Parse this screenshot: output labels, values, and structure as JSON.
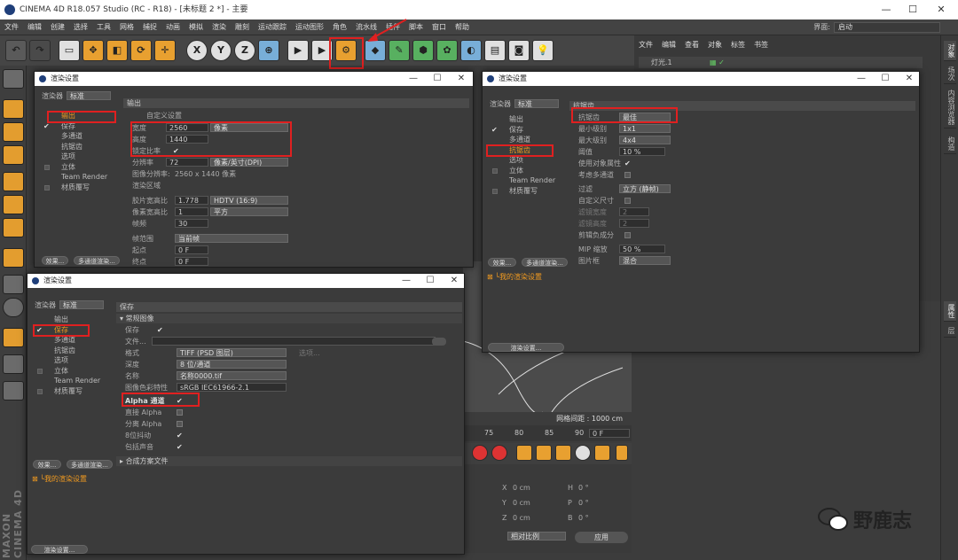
{
  "app": {
    "title": "CINEMA 4D R18.057 Studio (RC - R18) - [未标题 2 *] - 主要"
  },
  "menubar": {
    "items": [
      "文件",
      "编辑",
      "创建",
      "选择",
      "工具",
      "网格",
      "捕捉",
      "动画",
      "模拟",
      "渲染",
      "雕刻",
      "运动跟踪",
      "运动图形",
      "角色",
      "流水线",
      "插件",
      "脚本",
      "窗口",
      "帮助"
    ],
    "layout_label": "界面:",
    "layout_value": "启动"
  },
  "toolbar": {
    "x": "X",
    "y": "Y",
    "z": "Z"
  },
  "objmgr": {
    "menu": [
      "文件",
      "编辑",
      "查看",
      "对象",
      "标签",
      "书签"
    ],
    "object": "灯光.1"
  },
  "righttabs": [
    "对象",
    "场次",
    "内容浏览器",
    "构造",
    "属性",
    "层"
  ],
  "viewport": {
    "grid": "网格间距 : 1000 cm"
  },
  "timeline": {
    "ticks": [
      "75",
      "80",
      "85",
      "90"
    ],
    "frame": "0 F"
  },
  "coords": {
    "x": "X",
    "y": "Y",
    "z": "Z",
    "h": "H",
    "p": "P",
    "b": "B",
    "val": "0 cm",
    "ang": "0 °",
    "mode1": "相对比例",
    "apply": "应用"
  },
  "dlg1": {
    "title": "渲染设置",
    "renderer_label": "渲染器",
    "renderer_value": "标准",
    "nav": [
      {
        "label": "输出",
        "check": "",
        "sel": true
      },
      {
        "label": "保存",
        "check": "✔",
        "sel": false
      },
      {
        "label": "多通道",
        "check": "",
        "sel": false
      },
      {
        "label": "抗锯齿",
        "check": "",
        "sel": false
      },
      {
        "label": "选项",
        "check": "",
        "sel": false
      },
      {
        "label": "立体",
        "check": "box",
        "sel": false
      },
      {
        "label": "Team Render",
        "check": "",
        "sel": false
      },
      {
        "label": "材质覆写",
        "check": "box",
        "sel": false
      }
    ],
    "btn_effects": "效果...",
    "btn_multi": "多通道渲染...",
    "section": "输出",
    "preset": "自定义设置",
    "width_label": "宽度",
    "width_value": "2560",
    "unit": "像素",
    "height_label": "高度",
    "height_value": "1440",
    "lock_label": "锁定比率",
    "lock": "✔",
    "res_label": "分辨率",
    "res_value": "72",
    "res_unit": "像素/英寸(DPI)",
    "imgres_label": "图像分辨率:",
    "imgres_value": "2560 x 1440 像素",
    "region_label": "渲染区域",
    "film_label": "胶片宽高比",
    "film_value": "1.778",
    "film_preset": "HDTV (16:9)",
    "pixel_label": "像素宽高比",
    "pixel_value": "1",
    "pixel_preset": "平方",
    "fps_label": "帧频",
    "fps_value": "30",
    "range_label": "帧范围",
    "range_value": "当前帧",
    "start_label": "起点",
    "start_value": "0 F",
    "end_label": "终点",
    "end_value": "0 F"
  },
  "dlg2": {
    "title": "渲染设置",
    "renderer_label": "渲染器",
    "renderer_value": "标准",
    "nav": [
      {
        "label": "输出",
        "check": "",
        "sel": false
      },
      {
        "label": "保存",
        "check": "✔",
        "sel": true
      },
      {
        "label": "多通道",
        "check": "",
        "sel": false
      },
      {
        "label": "抗锯齿",
        "check": "",
        "sel": false
      },
      {
        "label": "选项",
        "check": "",
        "sel": false
      },
      {
        "label": "立体",
        "check": "box",
        "sel": false
      },
      {
        "label": "Team Render",
        "check": "",
        "sel": false
      },
      {
        "label": "材质覆写",
        "check": "box",
        "sel": false
      }
    ],
    "btn_effects": "效果...",
    "btn_multi": "多通道渲染...",
    "presets": "我的渲染设置",
    "btn_render": "渲染设置...",
    "section": "保存",
    "sub": "常规图像",
    "save_label": "保存",
    "save": "✔",
    "file_label": "文件...",
    "format_label": "格式",
    "format_value": "TIFF (PSD 图层)",
    "options": "选项...",
    "depth_label": "深度",
    "depth_value": "8 位/通道",
    "name_label": "名称",
    "name_value": "名称0000.tif",
    "profile_label": "图像色彩特性",
    "profile_value": "sRGB IEC61966-2.1",
    "alpha_label": "Alpha 通道",
    "alpha": "✔",
    "straight_label": "直接 Alpha",
    "sep_label": "分离 Alpha",
    "dither_label": "8位抖动",
    "dither": "✔",
    "sound_label": "包括声音",
    "sound": "✔",
    "composite": "合成方案文件"
  },
  "dlg3": {
    "title": "渲染设置",
    "renderer_label": "渲染器",
    "renderer_value": "标准",
    "nav": [
      {
        "label": "输出",
        "check": "",
        "sel": false
      },
      {
        "label": "保存",
        "check": "✔",
        "sel": false
      },
      {
        "label": "多通道",
        "check": "",
        "sel": false
      },
      {
        "label": "抗锯齿",
        "check": "",
        "sel": true
      },
      {
        "label": "选项",
        "check": "",
        "sel": false
      },
      {
        "label": "立体",
        "check": "box",
        "sel": false
      },
      {
        "label": "Team Render",
        "check": "",
        "sel": false
      },
      {
        "label": "材质覆写",
        "check": "box",
        "sel": false
      }
    ],
    "btn_effects": "效果...",
    "btn_multi": "多通道渲染...",
    "presets": "我的渲染设置",
    "btn_render": "渲染设置...",
    "section": "抗锯齿",
    "aa_label": "抗锯齿",
    "aa_value": "最佳",
    "min_label": "最小级别",
    "min_value": "1x1",
    "max_label": "最大级别",
    "max_value": "4x4",
    "thr_label": "阈值",
    "thr_value": "10 %",
    "objprop_label": "使用对象属性",
    "objprop": "✔",
    "multi_label": "考虑多通道",
    "filter_label": "过滤",
    "filter_value": "立方 (静帧)",
    "custom_label": "自定义尺寸",
    "fw_label": "滤镜宽度",
    "fw_value": "2",
    "fh_label": "滤镜高度",
    "fh_value": "2",
    "clip_label": "剪辑负成分",
    "mip_label": "MIP 缩放",
    "mip_value": "50 %",
    "hl_label": "图片框",
    "hl_value": "混合"
  },
  "watermark": {
    "text": "野鹿志"
  }
}
